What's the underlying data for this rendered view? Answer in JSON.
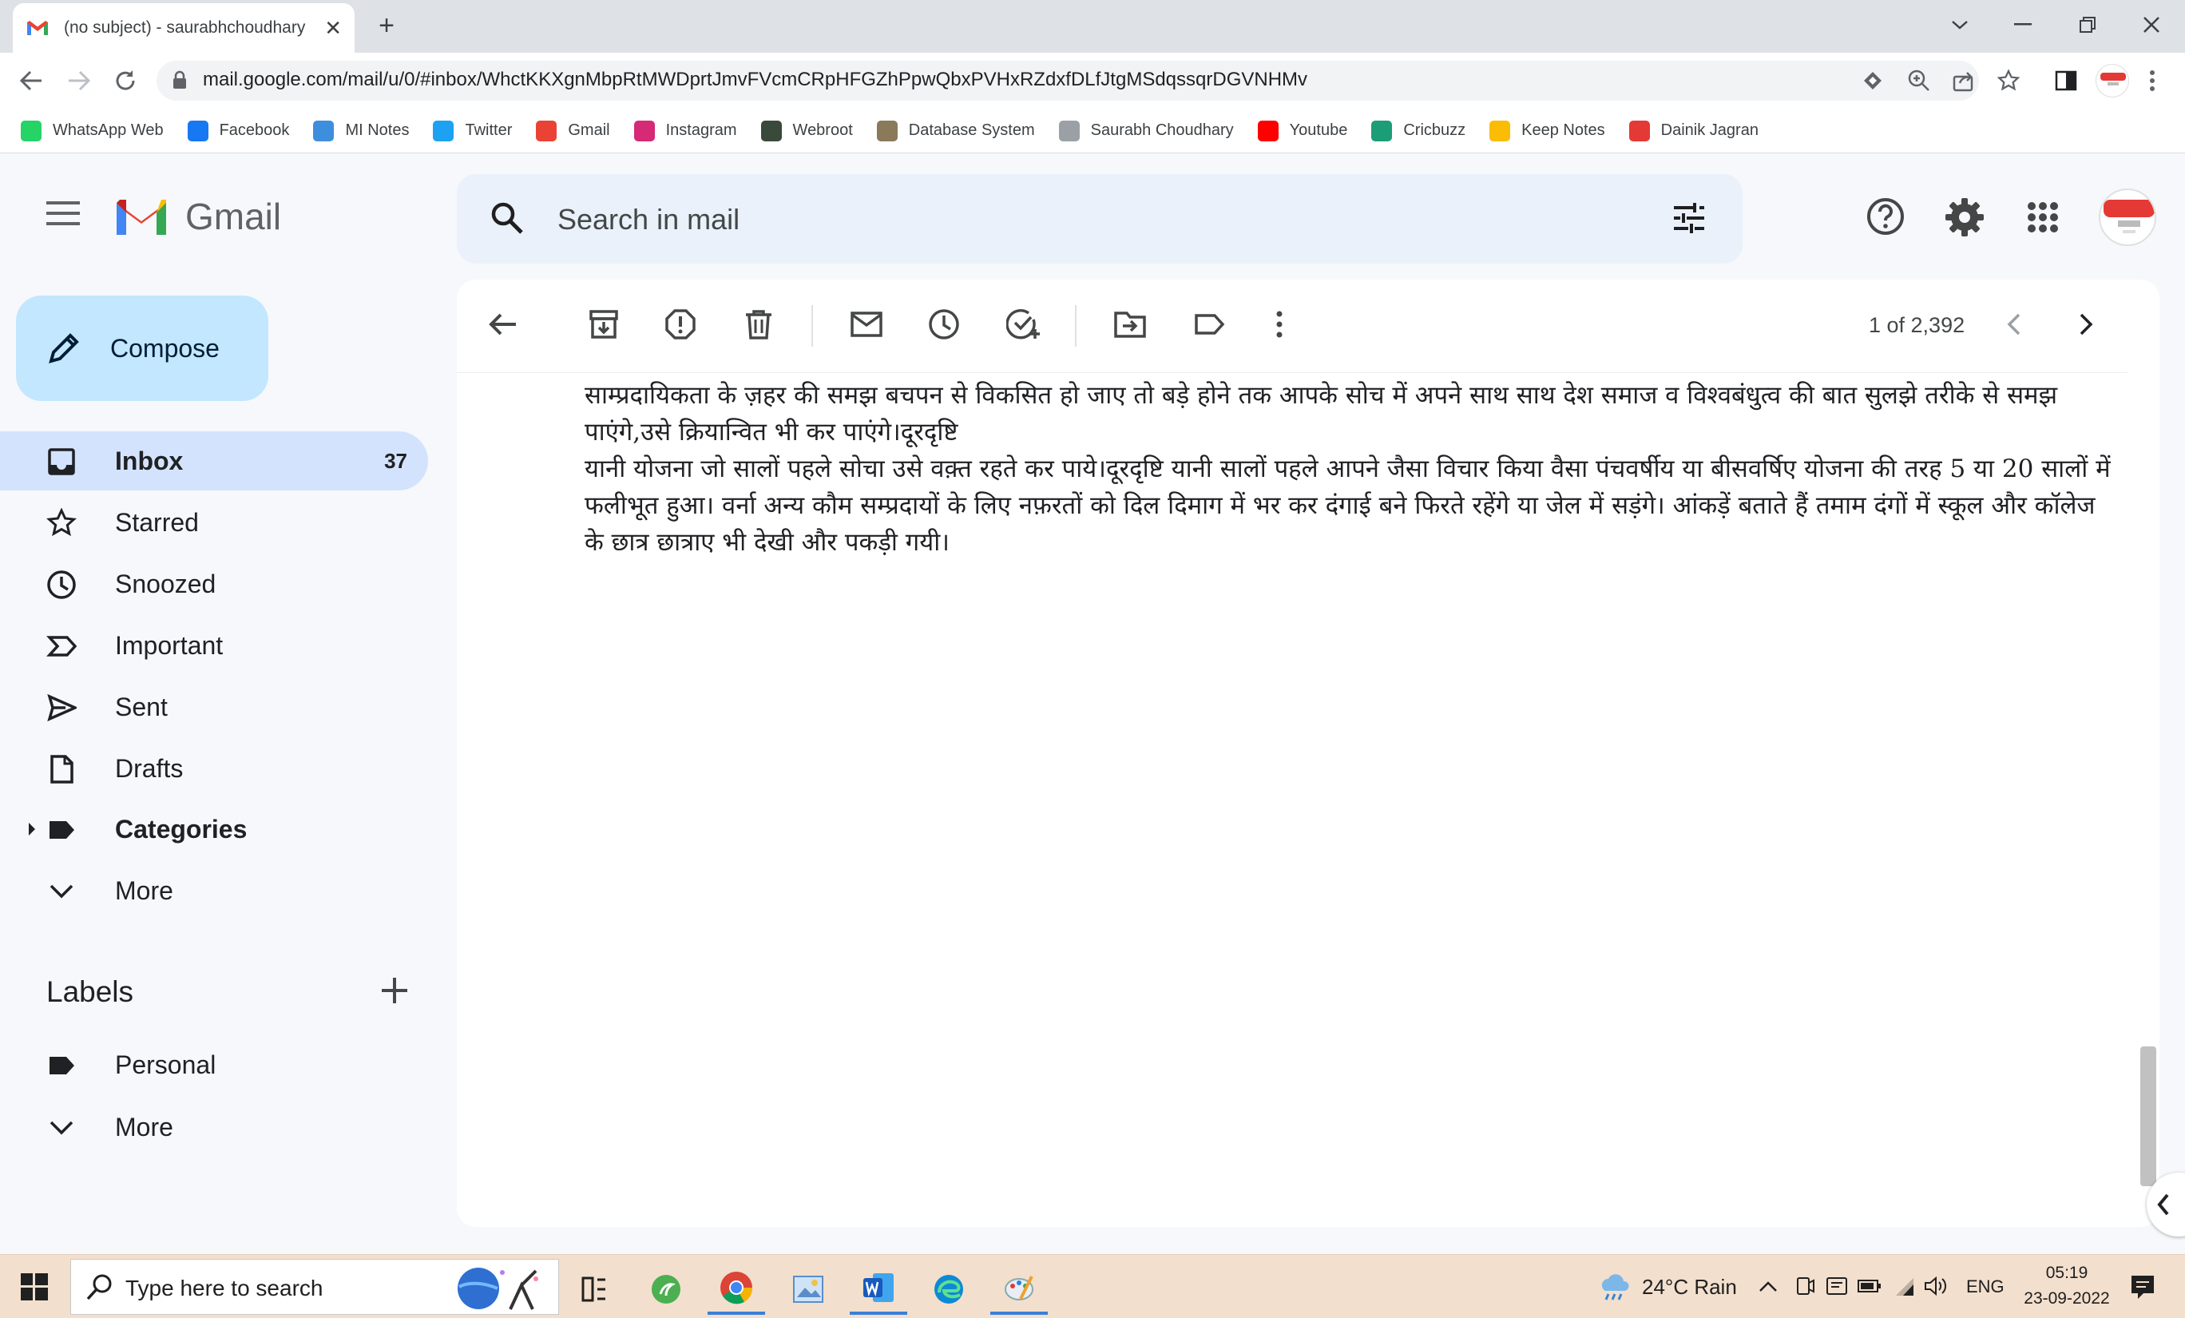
{
  "browser": {
    "tab_title": "(no subject) - saurabhchoudhary",
    "url": "mail.google.com/mail/u/0/#inbox/WhctKKXgnMbpRtMWDprtJmvFVcmCRpHFGZhPpwQbxPVHxRZdxfDLfJtgMSdqssqrDGVNHMv",
    "bookmarks": [
      {
        "label": "WhatsApp Web",
        "icon": "whatsapp-icon",
        "color": "#25d366"
      },
      {
        "label": "Facebook",
        "icon": "facebook-icon",
        "color": "#1877f2"
      },
      {
        "label": "MI Notes",
        "icon": "notes-icon",
        "color": "#3e8ede"
      },
      {
        "label": "Twitter",
        "icon": "twitter-icon",
        "color": "#1da1f2"
      },
      {
        "label": "Gmail",
        "icon": "gmail-icon",
        "color": "#ea4335"
      },
      {
        "label": "Instagram",
        "icon": "instagram-icon",
        "color": "#d62976"
      },
      {
        "label": "Webroot",
        "icon": "webroot-icon",
        "color": "#3a4a3a"
      },
      {
        "label": "Database System",
        "icon": "database-icon",
        "color": "#8a7a5a"
      },
      {
        "label": "Saurabh Choudhary",
        "icon": "document-icon",
        "color": "#9aa0a6"
      },
      {
        "label": "Youtube",
        "icon": "youtube-icon",
        "color": "#ff0000"
      },
      {
        "label": "Cricbuzz",
        "icon": "cricbuzz-icon",
        "color": "#1b9e77"
      },
      {
        "label": "Keep Notes",
        "icon": "keep-icon",
        "color": "#fbbc04"
      },
      {
        "label": "Dainik Jagran",
        "icon": "dainik-jagran-icon",
        "color": "#e53935"
      }
    ]
  },
  "gmail": {
    "app_name": "Gmail",
    "search_placeholder": "Search in mail",
    "compose_label": "Compose",
    "nav": [
      {
        "label": "Inbox",
        "count": "37",
        "icon": "inbox-icon",
        "active": true
      },
      {
        "label": "Starred",
        "icon": "star-icon"
      },
      {
        "label": "Snoozed",
        "icon": "clock-icon"
      },
      {
        "label": "Important",
        "icon": "important-icon"
      },
      {
        "label": "Sent",
        "icon": "send-icon"
      },
      {
        "label": "Drafts",
        "icon": "draft-icon"
      },
      {
        "label": "Categories",
        "icon": "label-icon"
      },
      {
        "label": "More",
        "icon": "chevron-down-icon"
      }
    ],
    "labels_heading": "Labels",
    "labels": [
      {
        "label": "Personal",
        "icon": "label-icon"
      },
      {
        "label": "More",
        "icon": "chevron-down-icon"
      }
    ],
    "pagination": "1 of 2,392",
    "message_lines": [
      "साम्प्रदायिकता के ज़हर की समझ बचपन से विकसित हो जाए तो बड़े होने तक आपके सोच में अपने साथ साथ देश समाज व विश्वबंधुत्व की बात सुलझे तरीके से समझ",
      "पाएंगे,उसे क्रियान्वित भी कर पाएंगे।दूरदृष्टि",
      "यानी योजना जो सालों पहले सोचा उसे वक़्त रहते कर पाये।दूरदृष्टि यानी सालों पहले आपने जैसा विचार किया  वैसा पंचवर्षीय या बीसवर्षिए योजना की तरह 5 या 20 सालों में",
      "फलीभूत हुआ। वर्ना अन्य कौम सम्प्रदायों के लिए नफ़रतों को दिल दिमाग में भर कर दंगाई बने फिरते रहेंगे या जेल में सड़ंगे। आंकड़ें बताते हैं तमाम दंगों में स्कूल और कॉलेज",
      "के छात्र छात्राए भी देखी और पकड़ी गयी।"
    ]
  },
  "taskbar": {
    "search_placeholder": "Type here to search",
    "weather": "24°C  Rain",
    "language": "ENG",
    "time": "05:19",
    "date": "23-09-2022"
  }
}
